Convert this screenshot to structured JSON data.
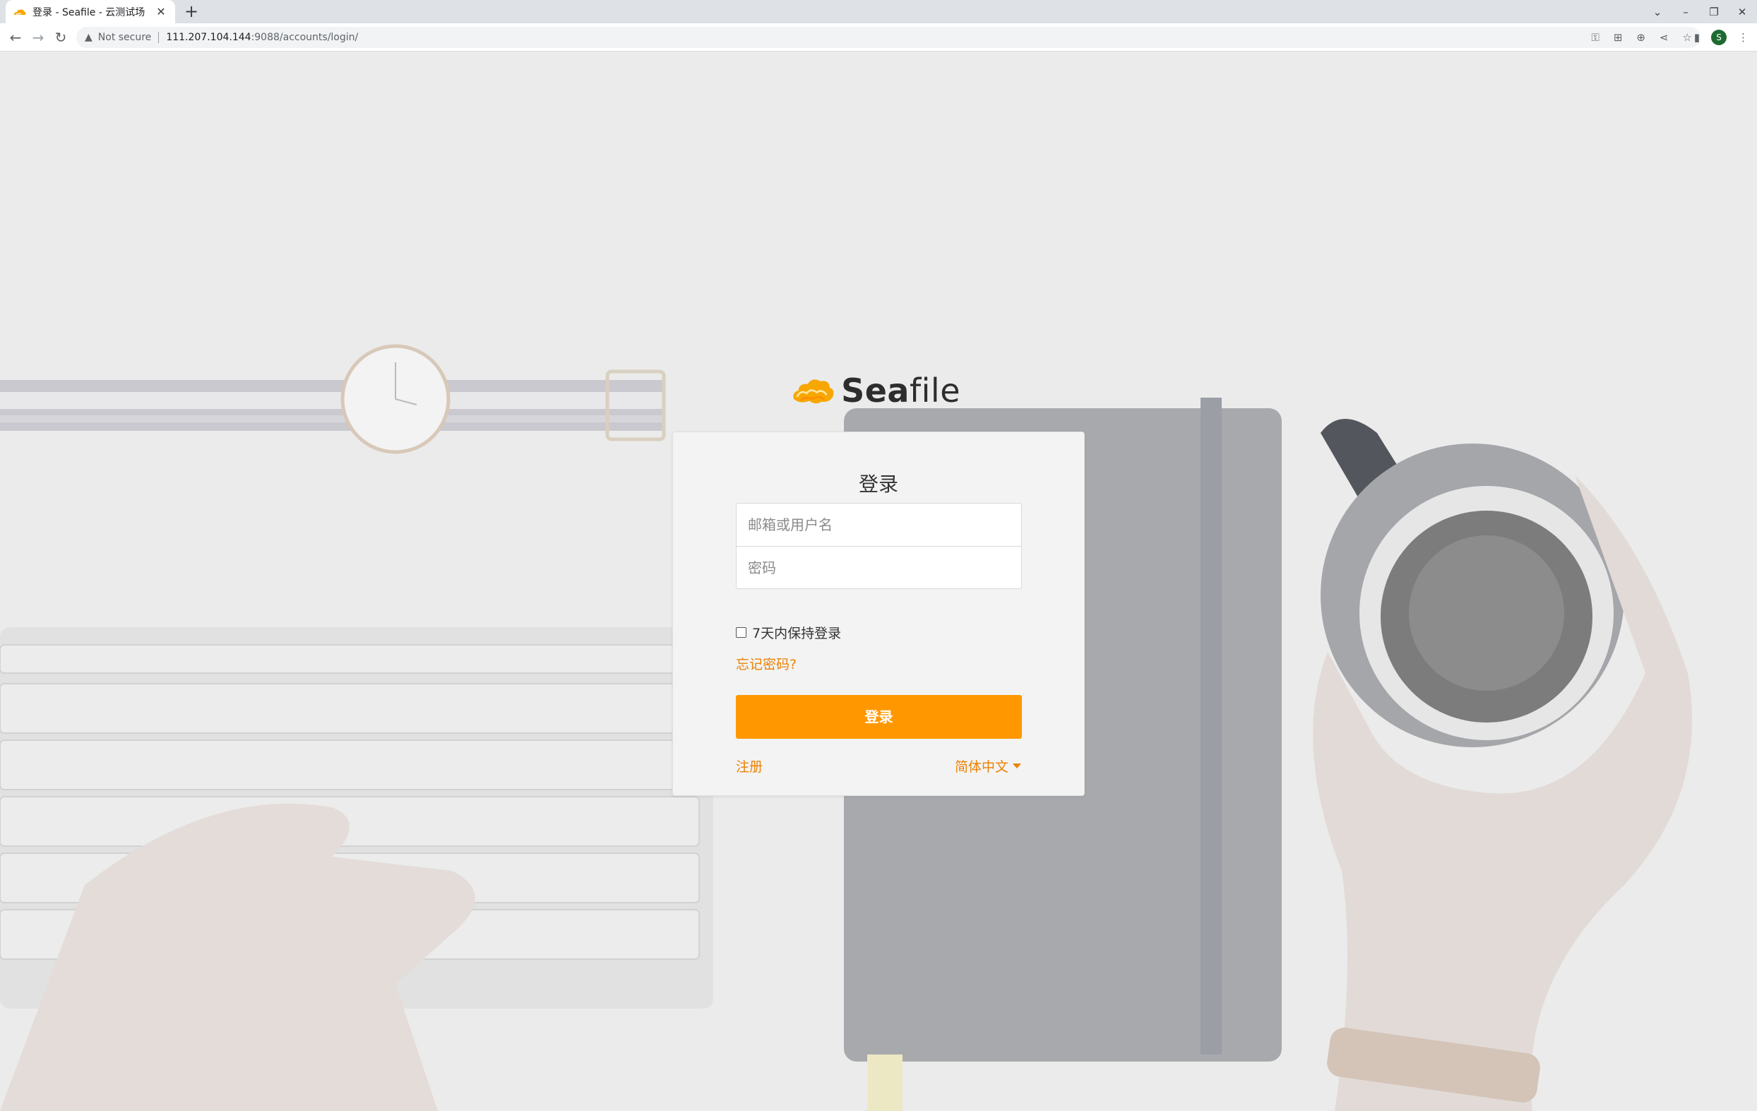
{
  "browser": {
    "tab_title": "登录 - Seafile - 云测试场",
    "tab_close": "✕",
    "new_tab": "+",
    "security_label": "Not secure",
    "url_host": "111.207.104.144",
    "url_path": ":9088/accounts/login/",
    "avatar_letter": "S"
  },
  "logo": {
    "text_bold": "Sea",
    "text_light": "file"
  },
  "login": {
    "title": "登录",
    "username_placeholder": "邮箱或用户名",
    "password_placeholder": "密码",
    "remember_label": "7天内保持登录",
    "forgot_link": "忘记密码?",
    "submit_label": "登录",
    "signup_link": "注册",
    "language": "简体中文"
  },
  "colors": {
    "accent": "#ff9800",
    "link": "#eb8205",
    "page_bg": "#ebebeb"
  },
  "icons": [
    "seafile-logo-icon",
    "back-icon",
    "forward-icon",
    "reload-icon",
    "warning-icon",
    "key-icon",
    "translate-icon",
    "zoom-icon",
    "share-icon",
    "star-icon",
    "sidebar-icon",
    "menu-icon"
  ]
}
